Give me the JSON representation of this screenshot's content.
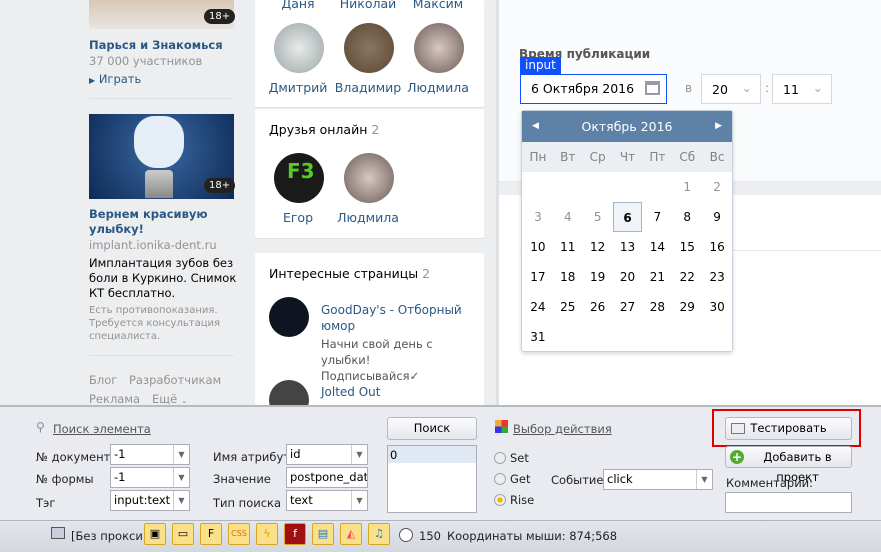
{
  "left": {
    "game": {
      "title": "Парься и Знакомься",
      "members": "37 000 участников",
      "play": "Играть",
      "badge": "18+"
    },
    "ad": {
      "title": "Вернем красивую улыбку!",
      "domain": "implant.ionika-dent.ru",
      "text": "Имплантация зубов без боли в Куркино. Снимок КТ бесплатно.",
      "note": "Есть противопоказания. Требуется консультация специалиста.",
      "badge": "18+"
    },
    "footer": {
      "blog": "Блог",
      "dev": "Разработчикам",
      "ads": "Реклама",
      "more": "Ещё"
    }
  },
  "friends": {
    "top_names": [
      "Даня",
      "Николай",
      "Максим"
    ],
    "names": [
      "Дмитрий",
      "Владимир",
      "Людмила"
    ]
  },
  "online": {
    "title": "Друзья онлайн",
    "count": "2",
    "names": [
      "Егор",
      "Людмила"
    ]
  },
  "pages": {
    "title": "Интересные страницы",
    "count": "2",
    "items": [
      {
        "name": "GoodDay's - Отборный юмор",
        "desc": "Начни свой день с улыбки! Подписывайся✓"
      },
      {
        "name": "Jolted Out"
      }
    ]
  },
  "publish": {
    "label": "Время публикации",
    "tag": "input",
    "date": "6 Октября 2016",
    "at": "в",
    "hour": "20",
    "colon": ":",
    "minute": "11"
  },
  "calendar": {
    "month": "Октябрь 2016",
    "weekdays": [
      "Пн",
      "Вт",
      "Ср",
      "Чт",
      "Пт",
      "Сб",
      "Вс"
    ],
    "selected": 6,
    "weeks": [
      [
        "",
        "",
        "",
        "",
        "",
        "1",
        "2"
      ],
      [
        "3",
        "4",
        "5",
        "6",
        "7",
        "8",
        "9"
      ],
      [
        "10",
        "11",
        "12",
        "13",
        "14",
        "15",
        "16"
      ],
      [
        "17",
        "18",
        "19",
        "20",
        "21",
        "22",
        "23"
      ],
      [
        "24",
        "25",
        "26",
        "27",
        "28",
        "29",
        "30"
      ],
      [
        "31",
        "",
        "",
        "",
        "",
        "",
        ""
      ]
    ]
  },
  "panel": {
    "search_link": "Поиск элемента",
    "doc_label": "№ документа",
    "doc": "-1",
    "form_label": "№ формы",
    "form": "-1",
    "tag_label": "Тэг",
    "tag": "input:text",
    "attr_label": "Имя атрибута",
    "attr": "id",
    "value_label": "Значение",
    "value": "postpone_date:",
    "type_label": "Тип поиска",
    "type": "text",
    "search_btn": "Поиск",
    "results": [
      "0"
    ],
    "action_link": "Выбор действия",
    "set": "Set",
    "get": "Get",
    "rise": "Rise",
    "event_label": "Событие",
    "event": "click",
    "test_btn": "Тестировать",
    "add_btn": "Добавить в проект",
    "comment_label": "Комментарий:",
    "comment": ""
  },
  "status": {
    "proxy": "[Без прокси]",
    "timer": "150",
    "coords": "Координаты мыши: 874;568"
  },
  "colors": {
    "highlight": "#e00000",
    "accent": "#0f50ff"
  }
}
